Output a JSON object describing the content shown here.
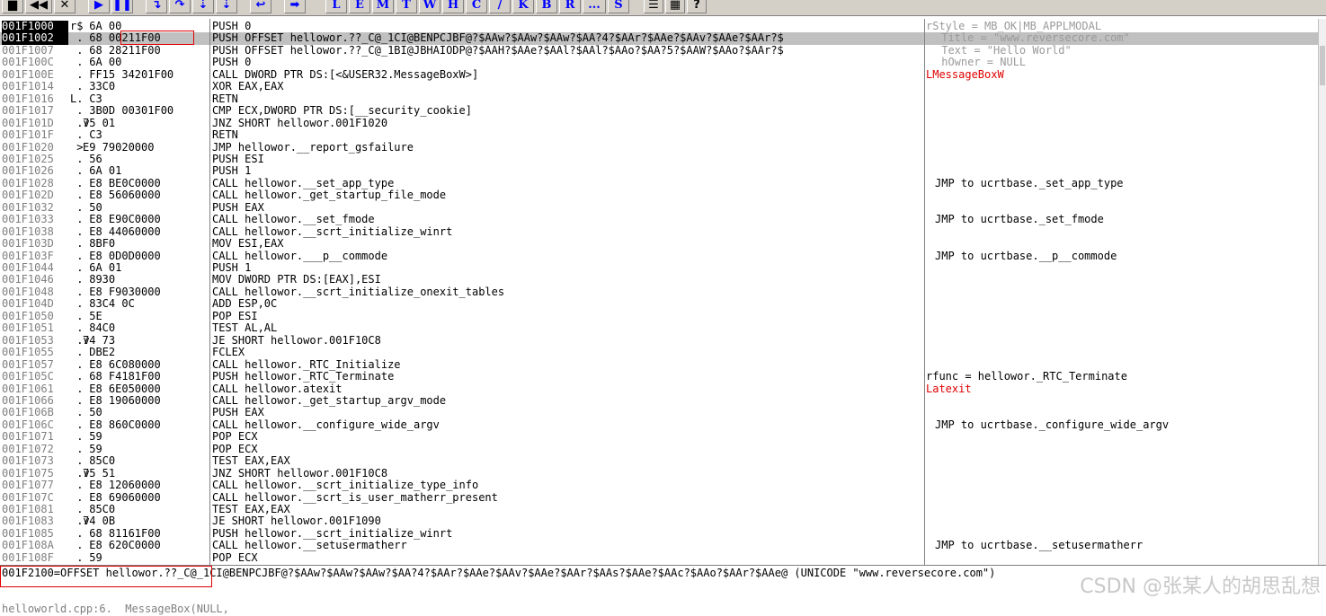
{
  "toolbar": {
    "buttons": [
      {
        "name": "open-icon",
        "glyph": "▆"
      },
      {
        "name": "restart-icon",
        "glyph": "◀◀"
      },
      {
        "name": "close-icon",
        "glyph": "✕"
      },
      {
        "name": "run-icon",
        "glyph": "▶"
      },
      {
        "name": "pause-icon",
        "glyph": "❚❚"
      },
      {
        "name": "step-into-icon",
        "glyph": "↴"
      },
      {
        "name": "step-over-icon",
        "glyph": "↷"
      },
      {
        "name": "trace-into-icon",
        "glyph": "⇣"
      },
      {
        "name": "trace-over-icon",
        "glyph": "⇣"
      },
      {
        "name": "execute-till-return-icon",
        "glyph": "↩"
      },
      {
        "name": "goto-icon",
        "glyph": "➡"
      }
    ],
    "window_letters": [
      "L",
      "E",
      "M",
      "T",
      "W",
      "H",
      "C",
      "/",
      "K",
      "B",
      "R",
      "...",
      "S"
    ],
    "extra": [
      {
        "name": "list-icon",
        "glyph": "☰"
      },
      {
        "name": "color-grid-icon",
        "glyph": "▦"
      },
      {
        "name": "help-icon",
        "glyph": "?"
      }
    ]
  },
  "rows": [
    {
      "addr": "001F1000",
      "brk": "r$",
      "hex": " 6A 00",
      "asm": "PUSH 0",
      "cmt": "rStyle = MB_OK|MB_APPLMODAL",
      "cmt_style": "grey",
      "eip": true
    },
    {
      "addr": "001F1002",
      "brk": " .",
      "hex": " 68 00211F00",
      "asm": "PUSH OFFSET hellowor.??_C@_1CI@BENPCJBF@?$AAw?$AAw?$AAw?$AA?4?$AAr?$AAe?$AAv?$AAe?$AAr?$",
      "cmt": " Title = \"www.reversecore.com\"",
      "cmt_style": "grey",
      "hl": true
    },
    {
      "addr": "001F1007",
      "brk": " .",
      "hex": " 68 28211F00",
      "asm": "PUSH OFFSET hellowor.??_C@_1BI@JBHAIODP@?$AAH?$AAe?$AAl?$AAl?$AAo?$AA?5?$AAW?$AAo?$AAr?$",
      "cmt": " Text = \"Hello World\"",
      "cmt_style": "grey"
    },
    {
      "addr": "001F100C",
      "brk": " .",
      "hex": " 6A 00",
      "asm": "PUSH 0",
      "cmt": " hOwner = NULL",
      "cmt_style": "grey"
    },
    {
      "addr": "001F100E",
      "brk": " .",
      "hex": " FF15 34201F00",
      "asm": "CALL DWORD PTR DS:[<&USER32.MessageBoxW>]",
      "cmt": "LMessageBoxW",
      "cmt_style": "red"
    },
    {
      "addr": "001F1014",
      "brk": " .",
      "hex": " 33C0",
      "asm": "XOR EAX,EAX",
      "cmt": ""
    },
    {
      "addr": "001F1016",
      "brk": "L.",
      "hex": " C3",
      "asm": "RETN",
      "cmt": ""
    },
    {
      "addr": "001F1017",
      "brk": " .",
      "hex": " 3B0D 00301F00",
      "asm": "CMP ECX,DWORD PTR DS:[__security_cookie]",
      "cmt": ""
    },
    {
      "addr": "001F101D",
      "brk": " .v",
      "hex": "75 01",
      "asm": "JNZ SHORT hellowor.001F1020",
      "cmt": ""
    },
    {
      "addr": "001F101F",
      "brk": " .",
      "hex": " C3",
      "asm": "RETN",
      "cmt": ""
    },
    {
      "addr": "001F1020",
      "brk": " >",
      "hex": "E9 79020000",
      "asm": "JMP hellowor.__report_gsfailure",
      "cmt": ""
    },
    {
      "addr": "001F1025",
      "brk": " .",
      "hex": " 56",
      "asm": "PUSH ESI",
      "cmt": ""
    },
    {
      "addr": "001F1026",
      "brk": " .",
      "hex": " 6A 01",
      "asm": "PUSH 1",
      "cmt": ""
    },
    {
      "addr": "001F1028",
      "brk": " .",
      "hex": " E8 BE0C0000",
      "asm": "CALL hellowor.__set_app_type",
      "cmt": "JMP to ucrtbase._set_app_type"
    },
    {
      "addr": "001F102D",
      "brk": " .",
      "hex": " E8 56060000",
      "asm": "CALL hellowor._get_startup_file_mode",
      "cmt": ""
    },
    {
      "addr": "001F1032",
      "brk": " .",
      "hex": " 50",
      "asm": "PUSH EAX",
      "cmt": ""
    },
    {
      "addr": "001F1033",
      "brk": " .",
      "hex": " E8 E90C0000",
      "asm": "CALL hellowor.__set_fmode",
      "cmt": "JMP to ucrtbase._set_fmode"
    },
    {
      "addr": "001F1038",
      "brk": " .",
      "hex": " E8 44060000",
      "asm": "CALL hellowor.__scrt_initialize_winrt",
      "cmt": ""
    },
    {
      "addr": "001F103D",
      "brk": " .",
      "hex": " 8BF0",
      "asm": "MOV ESI,EAX",
      "cmt": ""
    },
    {
      "addr": "001F103F",
      "brk": " .",
      "hex": " E8 0D0D0000",
      "asm": "CALL hellowor.___p__commode",
      "cmt": "JMP to ucrtbase.__p__commode"
    },
    {
      "addr": "001F1044",
      "brk": " .",
      "hex": " 6A 01",
      "asm": "PUSH 1",
      "cmt": ""
    },
    {
      "addr": "001F1046",
      "brk": " .",
      "hex": " 8930",
      "asm": "MOV DWORD PTR DS:[EAX],ESI",
      "cmt": ""
    },
    {
      "addr": "001F1048",
      "brk": " .",
      "hex": " E8 F9030000",
      "asm": "CALL hellowor.__scrt_initialize_onexit_tables",
      "cmt": ""
    },
    {
      "addr": "001F104D",
      "brk": " .",
      "hex": " 83C4 0C",
      "asm": "ADD ESP,0C",
      "cmt": ""
    },
    {
      "addr": "001F1050",
      "brk": " .",
      "hex": " 5E",
      "asm": "POP ESI",
      "cmt": ""
    },
    {
      "addr": "001F1051",
      "brk": " .",
      "hex": " 84C0",
      "asm": "TEST AL,AL",
      "cmt": ""
    },
    {
      "addr": "001F1053",
      "brk": " .v",
      "hex": "74 73",
      "asm": "JE SHORT hellowor.001F10C8",
      "cmt": ""
    },
    {
      "addr": "001F1055",
      "brk": " .",
      "hex": " DBE2",
      "asm": "FCLEX",
      "cmt": ""
    },
    {
      "addr": "001F1057",
      "brk": " .",
      "hex": " E8 6C080000",
      "asm": "CALL hellowor._RTC_Initialize",
      "cmt": ""
    },
    {
      "addr": "001F105C",
      "brk": " .",
      "hex": " 68 F4181F00",
      "asm": "PUSH hellowor._RTC_Terminate",
      "cmt": "rfunc = hellowor._RTC_Terminate"
    },
    {
      "addr": "001F1061",
      "brk": " .",
      "hex": " E8 6E050000",
      "asm": "CALL hellowor.atexit",
      "cmt": "Latexit",
      "cmt_style": "red"
    },
    {
      "addr": "001F1066",
      "brk": " .",
      "hex": " E8 19060000",
      "asm": "CALL hellowor._get_startup_argv_mode",
      "cmt": ""
    },
    {
      "addr": "001F106B",
      "brk": " .",
      "hex": " 50",
      "asm": "PUSH EAX",
      "cmt": ""
    },
    {
      "addr": "001F106C",
      "brk": " .",
      "hex": " E8 860C0000",
      "asm": "CALL hellowor.__configure_wide_argv",
      "cmt": "JMP to ucrtbase._configure_wide_argv"
    },
    {
      "addr": "001F1071",
      "brk": " .",
      "hex": " 59",
      "asm": "POP ECX",
      "cmt": ""
    },
    {
      "addr": "001F1072",
      "brk": " .",
      "hex": " 59",
      "asm": "POP ECX",
      "cmt": ""
    },
    {
      "addr": "001F1073",
      "brk": " .",
      "hex": " 85C0",
      "asm": "TEST EAX,EAX",
      "cmt": ""
    },
    {
      "addr": "001F1075",
      "brk": " .v",
      "hex": "75 51",
      "asm": "JNZ SHORT hellowor.001F10C8",
      "cmt": ""
    },
    {
      "addr": "001F1077",
      "brk": " .",
      "hex": " E8 12060000",
      "asm": "CALL hellowor.__scrt_initialize_type_info",
      "cmt": ""
    },
    {
      "addr": "001F107C",
      "brk": " .",
      "hex": " E8 69060000",
      "asm": "CALL hellowor.__scrt_is_user_matherr_present",
      "cmt": ""
    },
    {
      "addr": "001F1081",
      "brk": " .",
      "hex": " 85C0",
      "asm": "TEST EAX,EAX",
      "cmt": ""
    },
    {
      "addr": "001F1083",
      "brk": " .v",
      "hex": "74 0B",
      "asm": "JE SHORT hellowor.001F1090",
      "cmt": ""
    },
    {
      "addr": "001F1085",
      "brk": " .",
      "hex": " 68 81161F00",
      "asm": "PUSH hellowor.__scrt_initialize_winrt",
      "cmt": ""
    },
    {
      "addr": "001F108A",
      "brk": " .",
      "hex": " E8 620C0000",
      "asm": "CALL hellowor.__setusermatherr",
      "cmt": "JMP to ucrtbase.__setusermatherr"
    },
    {
      "addr": "001F108F",
      "brk": " .",
      "hex": " 59",
      "asm": "POP ECX",
      "cmt": ""
    }
  ],
  "info": {
    "line1": "001F2100=OFFSET hellowor.??_C@_1CI@BENPCJBF@?$AAw?$AAw?$AAw?$AA?4?$AAr?$AAe?$AAv?$AAe?$AAr?$AAs?$AAe?$AAc?$AAo?$AAr?$AAe@ (UNICODE \"www.reversecore.com\")",
    "line2": "helloworld.cpp:6.  MessageBox(NULL,"
  },
  "watermark": "CSDN @张某人的胡思乱想",
  "colors": {
    "highlight": "#c0c0c0",
    "comment_red": "#e00000",
    "toolbar": "#d4d0c8"
  }
}
